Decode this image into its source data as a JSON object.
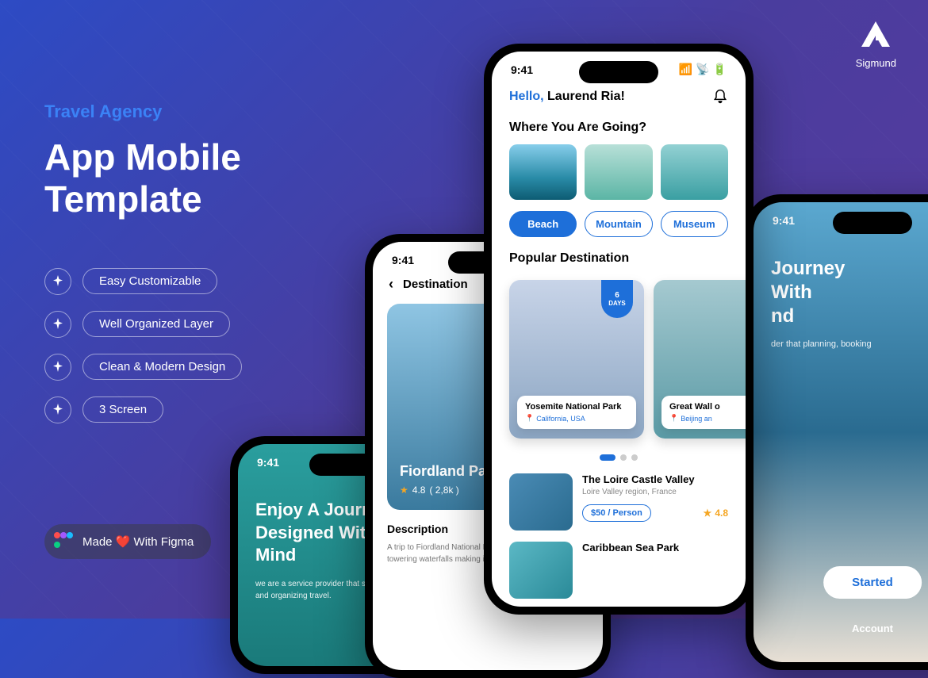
{
  "brand": {
    "name": "Sigmund"
  },
  "marketing": {
    "subtitle": "Travel Agency",
    "title_l1": "App Mobile",
    "title_l2": "Template",
    "features": [
      "Easy Customizable",
      "Well Organized Layer",
      "Clean & Modern Design",
      "3 Screen"
    ],
    "badge": "Made ❤️ With Figma"
  },
  "phone1": {
    "time": "9:41",
    "hello_prefix": "Hello, ",
    "hello_name": "Laurend Ria!",
    "section1": "Where You Are Going?",
    "chips": [
      "Beach",
      "Mountain",
      "Museum"
    ],
    "section2": "Popular Destination",
    "card1": {
      "badge_n": "6",
      "badge_t": "DAYS",
      "title": "Yosemite National Park",
      "sub": "California, USA"
    },
    "card2": {
      "title": "Great Wall o",
      "sub": "Beijing an"
    },
    "list1": {
      "title": "The Loire Castle Valley",
      "sub": "Loire Valley region, France",
      "price": "$50 / Person",
      "rating": "4.8"
    },
    "list2": {
      "title": "Caribbean Sea Park"
    }
  },
  "phone2": {
    "time": "9:41",
    "header": "Destination",
    "title": "Fiordland Park",
    "rating": "4.8",
    "rating_count": "( 2,8k )",
    "desc_h": "Description",
    "desc_p": "A trip to Fiordland National Park offers dramatic fjords, towering waterfalls making it a paradise for nature lovers"
  },
  "phone3": {
    "time": "9:41",
    "title": "Enjoy A Journey Designed With You In Mind",
    "sub": "we are a service provider that specializes in planning and organizing travel."
  },
  "phone4": {
    "title_l1": "Journey",
    "title_l2": "With",
    "title_l3": "nd",
    "sub": "der that planning, booking",
    "button": "Started",
    "account": "Account"
  }
}
